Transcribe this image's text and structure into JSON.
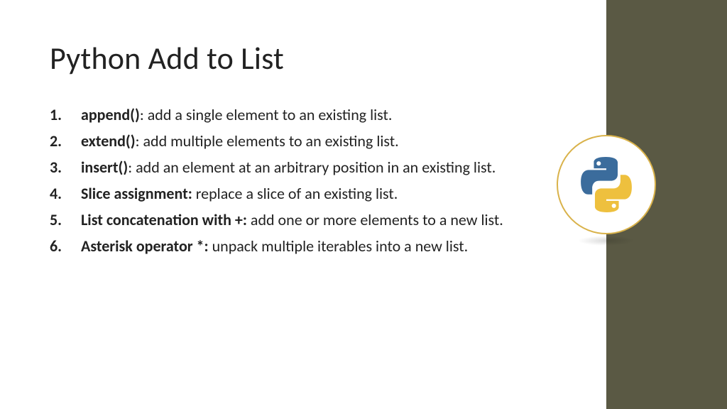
{
  "title": "Python Add to List",
  "items": [
    {
      "term": "append()",
      "sep": ": ",
      "desc": "add a single element to an existing list."
    },
    {
      "term": "extend()",
      "sep": ": ",
      "desc": "add multiple elements to an existing list."
    },
    {
      "term": "insert()",
      "sep": ": ",
      "desc": "add an element at an arbitrary position in an existing list."
    },
    {
      "term": "Slice assignment:",
      "sep": " ",
      "desc": "replace a slice of an existing list."
    },
    {
      "term": "List concatenation with +:",
      "sep": " ",
      "desc": "add one or more elements to a new list."
    },
    {
      "term": "Asterisk operator *:",
      "sep": " ",
      "desc": "unpack multiple iterables into a new list."
    }
  ],
  "logo_name": "python-logo"
}
